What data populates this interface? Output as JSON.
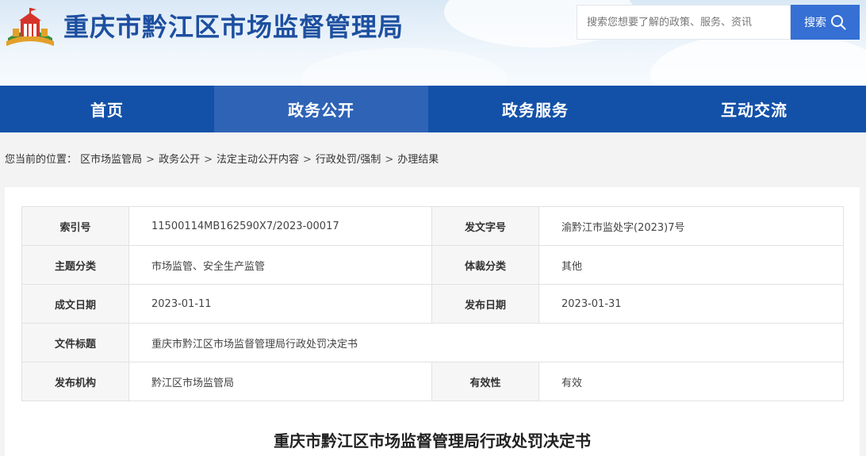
{
  "header": {
    "site_title": "重庆市黔江区市场监督管理局",
    "search": {
      "placeholder": "搜索您想要了解的政策、服务、资讯",
      "button_label": "搜索"
    }
  },
  "nav": {
    "items": [
      {
        "label": "首页"
      },
      {
        "label": "政务公开"
      },
      {
        "label": "政务服务"
      },
      {
        "label": "互动交流"
      }
    ]
  },
  "breadcrumb": {
    "prefix": "您当前的位置：",
    "items": [
      "区市场监管局",
      "政务公开",
      "法定主动公开内容",
      "行政处罚/强制",
      "办理结果"
    ],
    "separator": ">"
  },
  "meta": {
    "index_no": {
      "label": "索引号",
      "value": "11500114MB162590X7/2023-00017"
    },
    "doc_no": {
      "label": "发文字号",
      "value": "渝黔江市监处字(2023)7号"
    },
    "subject": {
      "label": "主题分类",
      "value": "市场监管、安全生产监管"
    },
    "genre": {
      "label": "体裁分类",
      "value": "其他"
    },
    "created": {
      "label": "成文日期",
      "value": "2023-01-11"
    },
    "published": {
      "label": "发布日期",
      "value": "2023-01-31"
    },
    "title": {
      "label": "文件标题",
      "value": "重庆市黔江区市场监督管理局行政处罚决定书"
    },
    "issuer": {
      "label": "发布机构",
      "value": "黔江区市场监管局"
    },
    "validity": {
      "label": "有效性",
      "value": "有效"
    }
  },
  "document": {
    "title": "重庆市黔江区市场监督管理局行政处罚决定书"
  },
  "colors": {
    "nav_bg": "#1351a8",
    "nav_active": "#2e63b6",
    "title": "#1d4fa0",
    "search_button": "#3670d4"
  },
  "icons": {
    "logo": "government-building-logo",
    "search": "search-icon"
  }
}
